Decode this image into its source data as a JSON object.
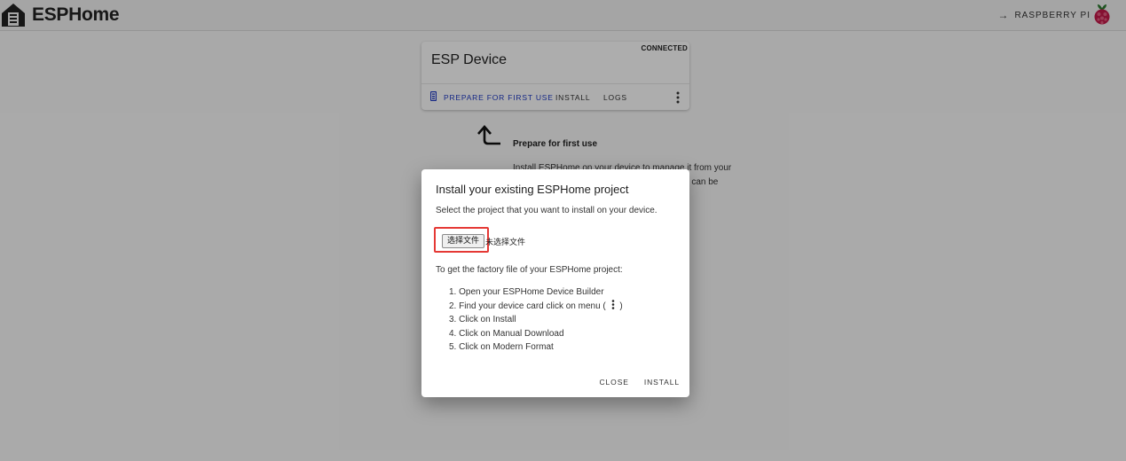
{
  "header": {
    "brand": "ESPHome",
    "link_label": "RASPBERRY PI",
    "logo_icon": "esphome-house-icon",
    "link_icon": "arrow-right-icon",
    "rpi_icon": "raspberry-pi-icon"
  },
  "device_card": {
    "status": "CONNECTED",
    "name": "ESP Device",
    "actions": {
      "prepare": "PREPARE FOR FIRST USE",
      "install": "INSTALL",
      "logs": "LOGS"
    },
    "prepare_icon": "usb-device-icon",
    "menu_icon": "kebab-menu-icon"
  },
  "hint": {
    "title": "Prepare for first use",
    "text": "Install ESPHome on your device to manage it from your",
    "text_line2": "ce can be",
    "arrow_icon": "curved-arrow-up-icon"
  },
  "dialog": {
    "title": "Install your existing ESPHome project",
    "description": "Select the project that you want to install on your device.",
    "file_button": "选择文件",
    "file_status": "未选择文件",
    "intro": "To get the factory file of your ESPHome project:",
    "steps": {
      "s1": "1. Open your ESPHome Device Builder",
      "s2_prefix": "2. Find your device card click on menu (",
      "s2_suffix": ")",
      "s3": "3. Click on Install",
      "s4": "4. Click on Manual Download",
      "s5": "5. Click on Modern Format"
    },
    "close": "CLOSE",
    "install": "INSTALL"
  },
  "colors": {
    "primary": "#1d38c4",
    "highlight": "#e53935",
    "raspberry": "#c51a4a"
  }
}
